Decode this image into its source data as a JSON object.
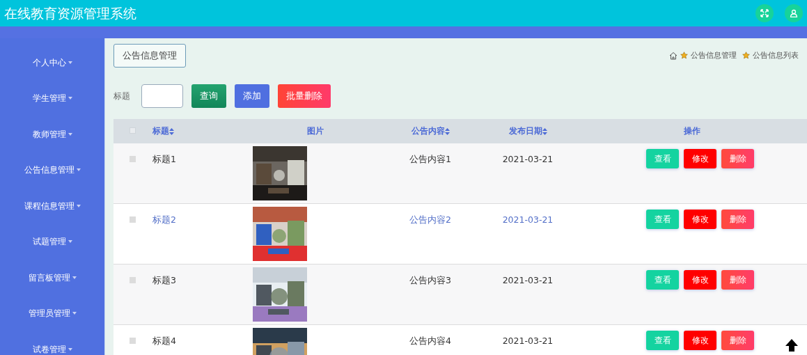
{
  "header": {
    "title": "在线教育资源管理系统"
  },
  "sidebar": {
    "items": [
      {
        "label": "个人中心"
      },
      {
        "label": "学生管理"
      },
      {
        "label": "教师管理"
      },
      {
        "label": "公告信息管理"
      },
      {
        "label": "课程信息管理"
      },
      {
        "label": "试题管理"
      },
      {
        "label": "留言板管理"
      },
      {
        "label": "管理员管理"
      },
      {
        "label": "试卷管理"
      }
    ]
  },
  "page_title": "公告信息管理",
  "breadcrumb": [
    "公告信息管理",
    "公告信息列表"
  ],
  "search": {
    "label": "标题",
    "buttons": [
      {
        "label": "查询",
        "kind": "search"
      },
      {
        "label": "添加",
        "kind": "add"
      },
      {
        "label": "批量删除",
        "kind": "delete"
      }
    ]
  },
  "table": {
    "select_all_checked": false,
    "columns": [
      {
        "label": "标题",
        "sortable": true
      },
      {
        "label": "图片",
        "sortable": false
      },
      {
        "label": "公告内容",
        "sortable": true
      },
      {
        "label": "发布日期",
        "sortable": true
      },
      {
        "label": "操作",
        "sortable": false
      }
    ],
    "rows": [
      {
        "title": "标题1",
        "content": "公告内容1",
        "date": "2021-03-21",
        "checked": false,
        "hovered": false,
        "picture": {
          "kind": "picture"
        },
        "actions": [
          {
            "label": "查看",
            "kind": "view"
          },
          {
            "label": "修改",
            "kind": "edit"
          },
          {
            "label": "删除",
            "kind": "delete"
          }
        ]
      },
      {
        "title": "标题2",
        "content": "公告内容2",
        "date": "2021-03-21",
        "checked": false,
        "hovered": true,
        "picture": {
          "kind": "picture"
        },
        "actions": [
          {
            "label": "查看",
            "kind": "view"
          },
          {
            "label": "修改",
            "kind": "edit"
          },
          {
            "label": "删除",
            "kind": "delete"
          }
        ]
      },
      {
        "title": "标题3",
        "content": "公告内容3",
        "date": "2021-03-21",
        "checked": false,
        "hovered": false,
        "picture": {
          "kind": "picture"
        },
        "actions": [
          {
            "label": "查看",
            "kind": "view"
          },
          {
            "label": "修改",
            "kind": "edit"
          },
          {
            "label": "删除",
            "kind": "delete"
          }
        ]
      },
      {
        "title": "标题4",
        "content": "公告内容4",
        "date": "2021-03-21",
        "checked": false,
        "hovered": false,
        "picture": {
          "kind": "picture"
        },
        "actions": [
          {
            "label": "查看",
            "kind": "view"
          },
          {
            "label": "修改",
            "kind": "edit"
          },
          {
            "label": "删除",
            "kind": "delete"
          }
        ]
      }
    ]
  }
}
